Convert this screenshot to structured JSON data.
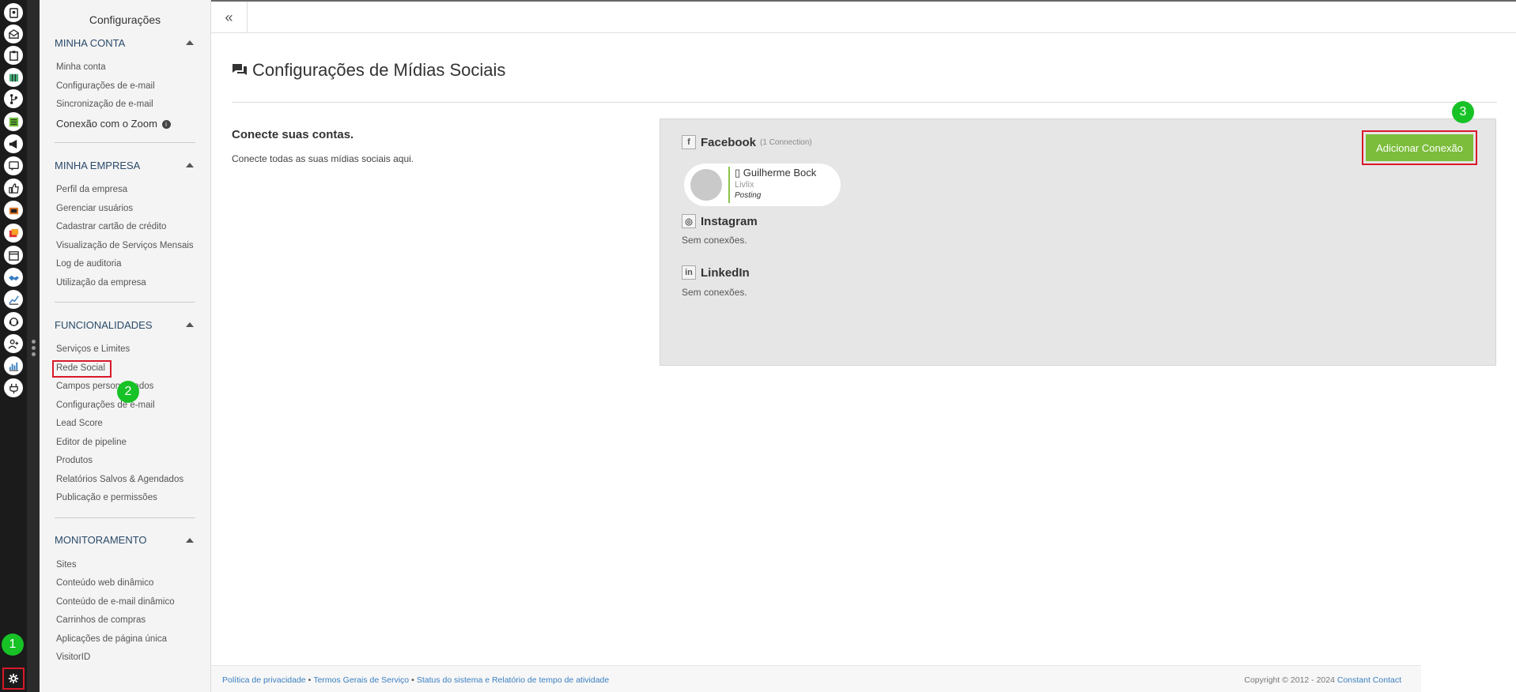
{
  "sidebar": {
    "title": "Configurações",
    "sections": [
      {
        "title": "MINHA CONTA",
        "items": [
          "Minha conta",
          "Configurações de e-mail",
          "Sincronização de e-mail",
          "Conexão com o Zoom"
        ]
      },
      {
        "title": "MINHA EMPRESA",
        "items": [
          "Perfil da empresa",
          "Gerenciar usuários",
          "Cadastrar cartão de crédito",
          "Visualização de Serviços Mensais",
          "Log de auditoria",
          "Utilização da empresa"
        ]
      },
      {
        "title": "FUNCIONALIDADES",
        "items": [
          "Serviços e Limites",
          "Rede Social",
          "Campos personalizados",
          "Configurações de e-mail",
          "Lead Score",
          "Editor de pipeline",
          "Produtos",
          "Relatórios Salvos & Agendados",
          "Publicação e permissões"
        ]
      },
      {
        "title": "MONITORAMENTO",
        "items": [
          "Sites",
          "Conteúdo web dinâmico",
          "Conteúdo de e-mail dinâmico",
          "Carrinhos de compras",
          "Aplicações de página única",
          "VisitorID"
        ]
      }
    ]
  },
  "badges": {
    "one": "1",
    "two": "2",
    "three": "3"
  },
  "topbar": {
    "collapse_label": "«"
  },
  "main": {
    "title": "Configurações de Mídias Sociais",
    "connect_heading": "Conecte suas contas.",
    "connect_text": "Conecte todas as suas mídias sociais aqui.",
    "add_button": "Adicionar Conexão",
    "facebook": {
      "name": "Facebook",
      "count": "(1 Connection)",
      "connection": {
        "name": "Guilherme Bock",
        "org": "Livlix",
        "role": "Posting"
      }
    },
    "instagram": {
      "name": "Instagram",
      "status": "Sem conexões."
    },
    "linkedin": {
      "name": "LinkedIn",
      "status": "Sem conexões."
    }
  },
  "footer": {
    "privacy": "Política de privacidade",
    "terms": "Termos Gerais de Serviço",
    "status": "Status do sistema e Relatório de tempo de atividade",
    "copyright": "Copyright © 2012 - 2024",
    "brand": "Constant Contact",
    "sep": "•"
  },
  "rail_icons": [
    "contacts-icon",
    "email-icon",
    "clipboard-icon",
    "map-icon",
    "branch-icon",
    "list-icon",
    "megaphone-icon",
    "chat-icon",
    "thumbs-up-icon",
    "tv-icon",
    "gallery-icon",
    "calendar-icon",
    "handshake-icon",
    "chart-icon",
    "support-icon",
    "add-user-icon",
    "bar-chart-icon",
    "plug-icon"
  ]
}
